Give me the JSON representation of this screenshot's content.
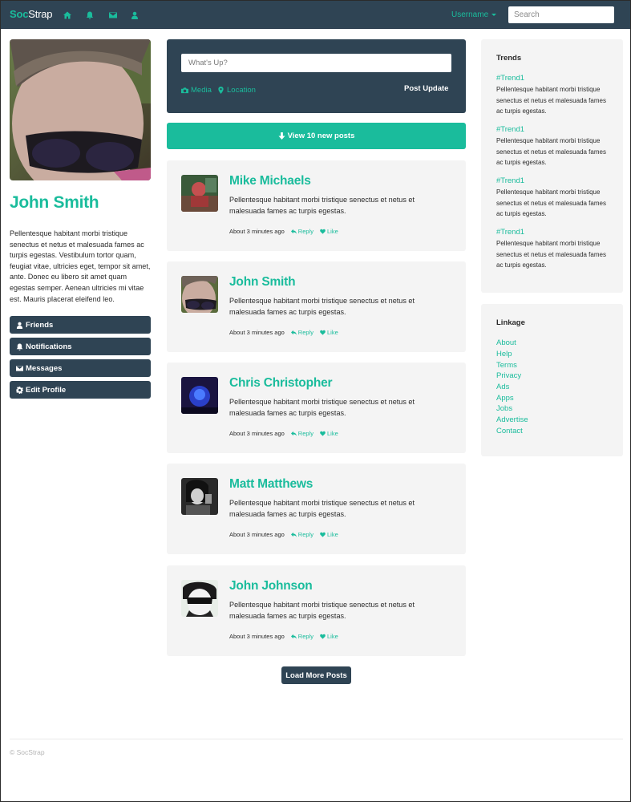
{
  "navbar": {
    "brand_part1": "Soc",
    "brand_part2": "Strap",
    "icons": [
      "home-icon",
      "bell-icon",
      "envelope-icon",
      "user-icon"
    ],
    "username": "Username",
    "search_placeholder": "Search"
  },
  "profile": {
    "name": "John Smith",
    "bio": "Pellentesque habitant morbi tristique senectus et netus et malesuada fames ac turpis egestas. Vestibulum tortor quam, feugiat vitae, ultricies eget, tempor sit amet, ante. Donec eu libero sit amet quam egestas semper. Aenean ultricies mi vitae est. Mauris placerat eleifend leo.",
    "buttons": [
      {
        "label": "Friends",
        "icon": "user-icon"
      },
      {
        "label": "Notifications",
        "icon": "bell-icon"
      },
      {
        "label": "Messages",
        "icon": "envelope-icon"
      },
      {
        "label": "Edit Profile",
        "icon": "gear-icon"
      }
    ]
  },
  "composer": {
    "placeholder": "What's Up?",
    "media_label": "Media",
    "location_label": "Location",
    "submit_label": "Post Update"
  },
  "new_posts_label": "View 10 new posts",
  "posts": [
    {
      "author": "Mike Michaels",
      "text": "Pellentesque habitant morbi tristique senectus et netus et malesuada fames ac turpis egestas.",
      "time": "About 3 minutes ago",
      "reply": "Reply",
      "like": "Like"
    },
    {
      "author": "John Smith",
      "text": "Pellentesque habitant morbi tristique senectus et netus et malesuada fames ac turpis egestas.",
      "time": "About 3 minutes ago",
      "reply": "Reply",
      "like": "Like"
    },
    {
      "author": "Chris Christopher",
      "text": "Pellentesque habitant morbi tristique senectus et netus et malesuada fames ac turpis egestas.",
      "time": "About 3 minutes ago",
      "reply": "Reply",
      "like": "Like"
    },
    {
      "author": "Matt Matthews",
      "text": "Pellentesque habitant morbi tristique senectus et netus et malesuada fames ac turpis egestas.",
      "time": "About 3 minutes ago",
      "reply": "Reply",
      "like": "Like"
    },
    {
      "author": "John Johnson",
      "text": "Pellentesque habitant morbi tristique senectus et netus et malesuada fames ac turpis egestas.",
      "time": "About 3 minutes ago",
      "reply": "Reply",
      "like": "Like"
    }
  ],
  "load_more_label": "Load More Posts",
  "trends": {
    "title": "Trends",
    "items": [
      {
        "tag": "#Trend1",
        "text": "Pellentesque habitant morbi tristique senectus et netus et malesuada fames ac turpis egestas."
      },
      {
        "tag": "#Trend1",
        "text": "Pellentesque habitant morbi tristique senectus et netus et malesuada fames ac turpis egestas."
      },
      {
        "tag": "#Trend1",
        "text": "Pellentesque habitant morbi tristique senectus et netus et malesuada fames ac turpis egestas."
      },
      {
        "tag": "#Trend1",
        "text": "Pellentesque habitant morbi tristique senectus et netus et malesuada fames ac turpis egestas."
      }
    ]
  },
  "linkage": {
    "title": "Linkage",
    "links": [
      "About",
      "Help",
      "Terms",
      "Privacy",
      "Ads",
      "Apps",
      "Jobs",
      "Advertise",
      "Contact"
    ]
  },
  "footer": {
    "copyright": "© SocStrap"
  },
  "colors": {
    "navy": "#2f4454",
    "teal": "#1abc9c",
    "panel": "#f4f4f4"
  }
}
